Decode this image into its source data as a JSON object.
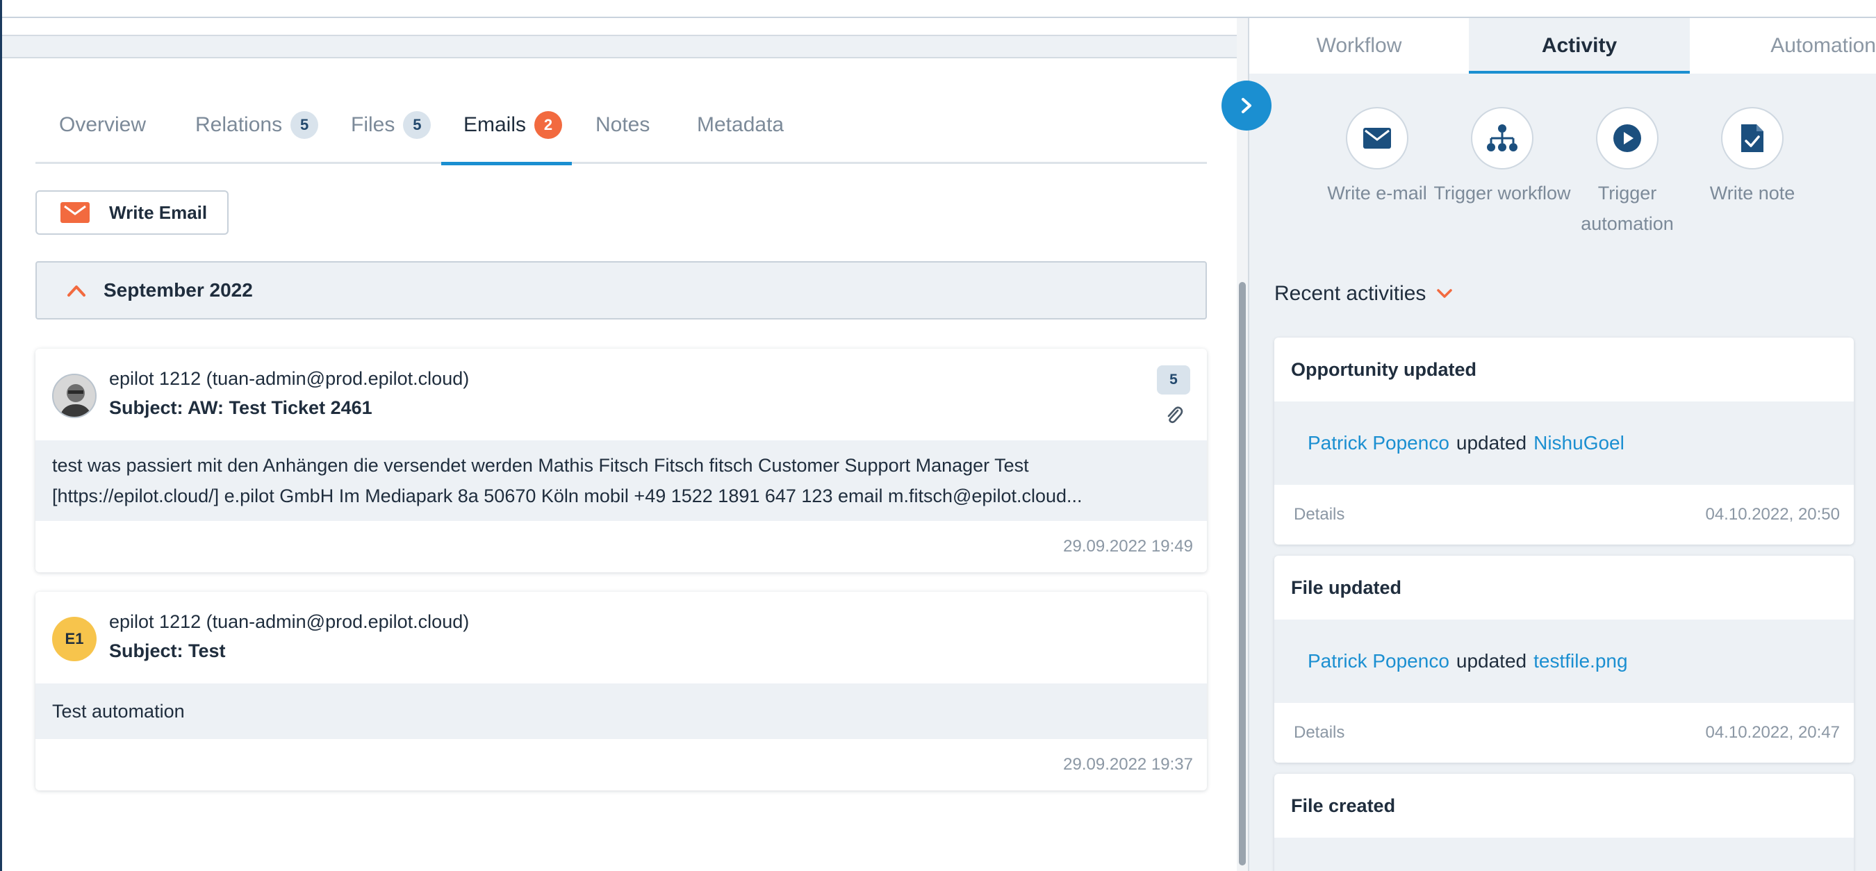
{
  "tabs": [
    {
      "label": "Overview",
      "badge": ""
    },
    {
      "label": "Relations",
      "badge": "5"
    },
    {
      "label": "Files",
      "badge": "5"
    },
    {
      "label": "Emails",
      "badge": "2"
    },
    {
      "label": "Notes",
      "badge": ""
    },
    {
      "label": "Metadata",
      "badge": ""
    }
  ],
  "active_tab": "Emails",
  "write_email": {
    "label": "Write Email"
  },
  "month_group": {
    "label": "September 2022"
  },
  "emails": [
    {
      "from": "epilot 1212 (tuan-admin@prod.epilot.cloud)",
      "subject": "Subject: AW: Test Ticket 2461",
      "attachment_count": "5",
      "body": "test was passiert mit den Anhängen die versendet werden Mathis Fitsch Fitsch fitsch Customer Support Manager Test [https://epilot.cloud/] e.pilot GmbH Im Mediapark 8a 50670 Köln mobil +49 1522 1891 647 123 email m.fitsch@epilot.cloud...",
      "timestamp": "29.09.2022 19:49",
      "avatar": "photo"
    },
    {
      "from": "epilot 1212 (tuan-admin@prod.epilot.cloud)",
      "subject": "Subject: Test",
      "initials": "E1",
      "body": "Test automation",
      "timestamp": "29.09.2022 19:37",
      "avatar": "initials"
    }
  ],
  "right_tabs": [
    {
      "label": "Workflow"
    },
    {
      "label": "Activity"
    },
    {
      "label": "Automation"
    }
  ],
  "right_active_tab": "Activity",
  "actions": [
    {
      "label": "Write e-mail",
      "icon": "envelope-icon"
    },
    {
      "label": "Trigger workflow",
      "icon": "hierarchy-icon"
    },
    {
      "label": "Trigger automation",
      "icon": "play-icon"
    },
    {
      "label": "Write note",
      "icon": "note-check-icon"
    }
  ],
  "recent_label": "Recent activities",
  "activities": [
    {
      "title": "Opportunity updated",
      "actor": "Patrick Popenco",
      "verb": "updated",
      "target": "NishuGoel",
      "details": "Details",
      "timestamp": "04.10.2022, 20:50"
    },
    {
      "title": "File updated",
      "actor": "Patrick Popenco",
      "verb": "updated",
      "target": "testfile.png",
      "details": "Details",
      "timestamp": "04.10.2022, 20:47"
    },
    {
      "title": "File created"
    }
  ],
  "colors": {
    "accent": "#1b8fd1",
    "orange": "#f26a3f",
    "panel": "#edf1f5",
    "text": "#1f2d3d",
    "muted": "#8b97a4"
  }
}
